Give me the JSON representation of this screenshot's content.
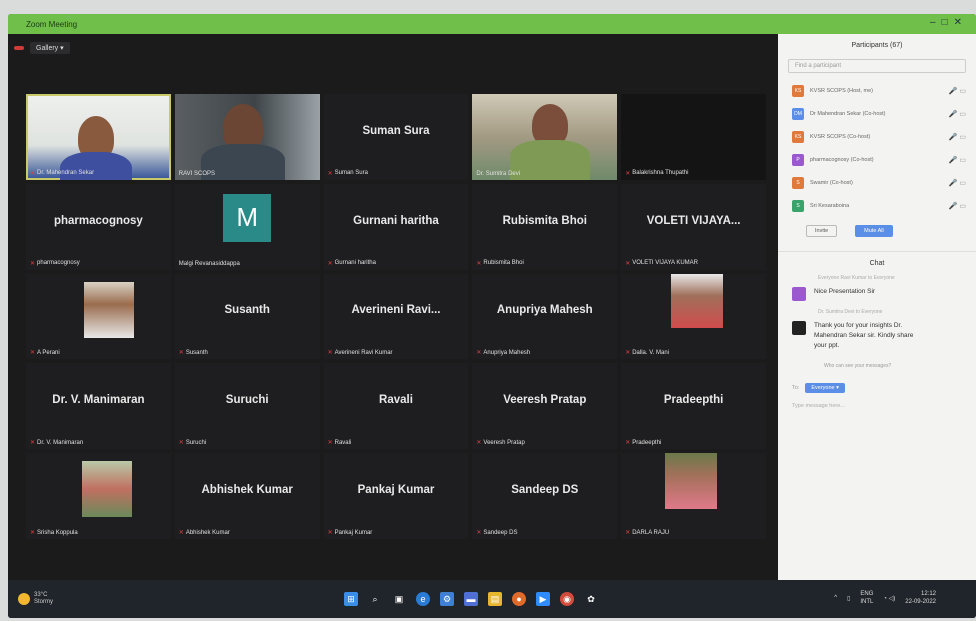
{
  "window": {
    "title": "Zoom Meeting"
  },
  "topbar": {
    "rec_label": "",
    "view_label": "Gallery"
  },
  "tiles": [
    {
      "name": "",
      "label": "Dr. Mahendran Sekar"
    },
    {
      "name": "",
      "label": "RAVI SCOPS"
    },
    {
      "name": "Suman Sura",
      "label": "Suman Sura"
    },
    {
      "name": "",
      "label": "Dr. Sumitra Devi"
    },
    {
      "name": "",
      "label": "Balakrishna Thupathi"
    },
    {
      "name": "pharmacognosy",
      "label": "pharmacognosy"
    },
    {
      "name": "",
      "avatar_letter": "M",
      "label": "Malgi Revanasiddappa"
    },
    {
      "name": "Gurnani haritha",
      "label": "Gurnani haritha"
    },
    {
      "name": "Rubismita Bhoi",
      "label": "Rubismita Bhoi"
    },
    {
      "name": "VOLETI VIJAYA...",
      "label": "VOLETI VIJAYA KUMAR"
    },
    {
      "name": "",
      "label": "A Perani"
    },
    {
      "name": "Susanth",
      "label": "Susanth"
    },
    {
      "name": "Averineni Ravi...",
      "label": "Averineni Ravi Kumar"
    },
    {
      "name": "Anupriya Mahesh",
      "label": "Anupriya Mahesh"
    },
    {
      "name": "",
      "label": "Dalla. V. Mani"
    },
    {
      "name": "Dr. V. Manimaran",
      "label": "Dr. V. Manimaran"
    },
    {
      "name": "Suruchi",
      "label": "Suruchi"
    },
    {
      "name": "Ravali",
      "label": "Ravali"
    },
    {
      "name": "Veeresh Pratap",
      "label": "Veeresh Pratap"
    },
    {
      "name": "Pradeepthi",
      "label": "Pradeepthi"
    },
    {
      "name": "",
      "label": "Srisha Koppula"
    },
    {
      "name": "Abhishek Kumar",
      "label": "Abhishek Kumar"
    },
    {
      "name": "Pankaj Kumar",
      "label": "Pankaj Kumar"
    },
    {
      "name": "Sandeep DS",
      "label": "Sandeep DS"
    },
    {
      "name": "",
      "label": "DARLA RAJU"
    }
  ],
  "participants": {
    "title": "Participants (67)",
    "search_placeholder": "Find a participant",
    "rows": [
      {
        "initials": "KS",
        "color": "#e07a3c",
        "name": "KVSR SCOPS (Host, me)"
      },
      {
        "initials": "DM",
        "color": "#5b8ee6",
        "name": "Dr Mahendran Sekar (Co-host)"
      },
      {
        "initials": "KS",
        "color": "#e07a3c",
        "name": "KVSR SCOPS (Co-host)"
      },
      {
        "initials": "P",
        "color": "#9b59d0",
        "name": "pharmacognosy (Co-host)"
      },
      {
        "initials": "S",
        "color": "#e07a3c",
        "name": "Swamir (Co-host)"
      },
      {
        "initials": "S",
        "color": "#3aa36a",
        "name": "Sri Kesaraboina"
      }
    ],
    "invite_label": "Invite",
    "mute_all_label": "Mute All"
  },
  "chat": {
    "title": "Chat",
    "meta1": "Everyone  Ravi Kumar to Everyone",
    "msg1": "Nice Presentation Sir",
    "meta2": "Dr. Sumitra Devi to Everyone",
    "msg2": "Thank you for your insights Dr. Mahendran Sekar sir. Kindly share your ppt.",
    "note": "Who can see your messages?",
    "to_label": "To:",
    "to_value": "Everyone",
    "input_placeholder": "Type message here..."
  },
  "taskbar": {
    "temp": "33°C",
    "weather": "Stormy",
    "lang": "ENG",
    "region": "INTL",
    "time": "12:12",
    "date": "22-09-2022"
  }
}
